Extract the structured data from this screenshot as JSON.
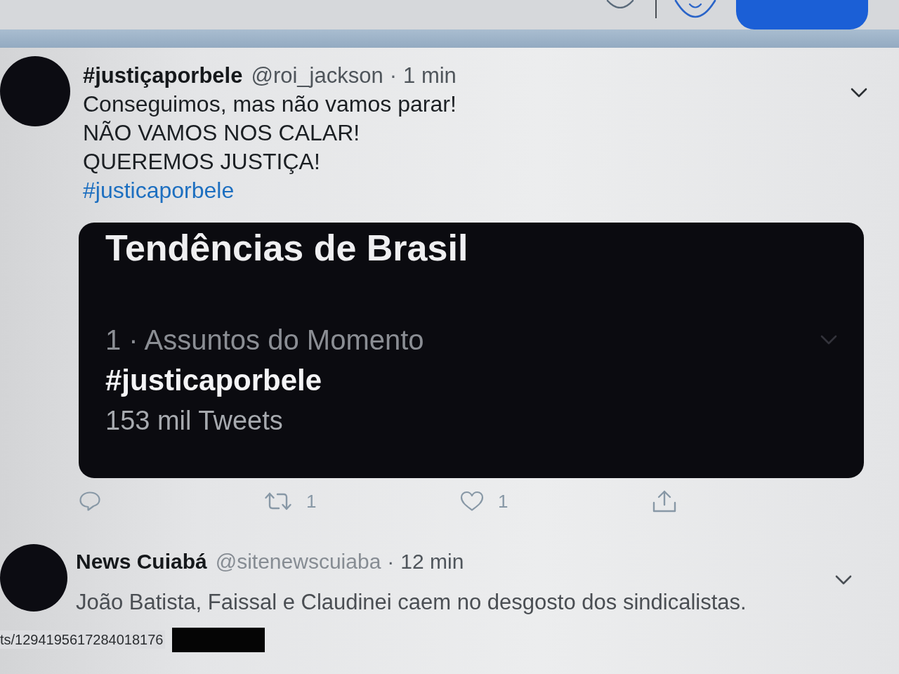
{
  "tweets": [
    {
      "display_name": "#justiçaporbele",
      "handle": "@roi_jackson",
      "separator": "·",
      "time": "1 min",
      "lines": [
        {
          "kind": "text",
          "text": "Conseguimos, mas não vamos parar!"
        },
        {
          "kind": "text",
          "text": "NÃO VAMOS NOS CALAR!"
        },
        {
          "kind": "text",
          "text": "QUEREMOS JUSTIÇA!"
        },
        {
          "kind": "hashtag",
          "text": "#justicaporbele"
        }
      ],
      "card": {
        "title": "Tendências de Brasil",
        "trend_meta": "1 · Assuntos do Momento",
        "trend_name": "#justicaporbele",
        "trend_count": "153 mil Tweets"
      },
      "actions": [
        {
          "kind": "reply"
        },
        {
          "kind": "retweet",
          "count": "1"
        },
        {
          "kind": "like",
          "count": "1"
        },
        {
          "kind": "share"
        }
      ]
    },
    {
      "display_name": "News Cuiabá",
      "handle": "@sitenewscuiaba",
      "separator": "·",
      "time": "12 min",
      "lines": [
        {
          "kind": "text",
          "text": "João Batista, Faissal e Claudinei caem no desgosto dos sindicalistas."
        }
      ]
    }
  ],
  "status_bar": {
    "url": "ts/1294195617284018176"
  }
}
